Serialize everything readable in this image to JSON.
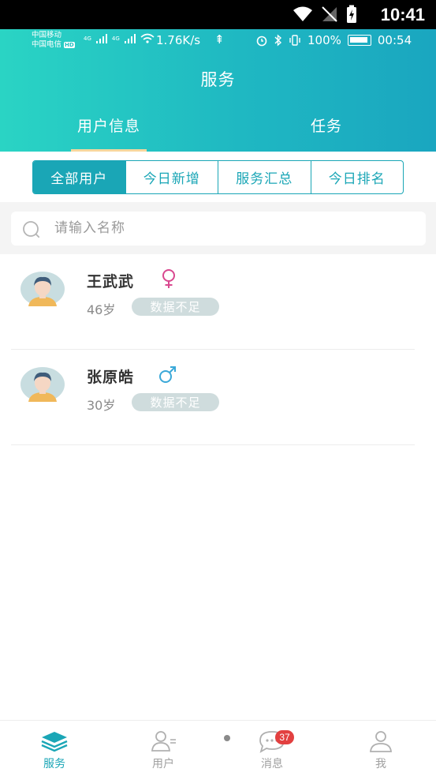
{
  "system_bar": {
    "time": "10:41"
  },
  "inner_status": {
    "carrier_1": "中国移动",
    "carrier_2": "中国电信",
    "hd": "HD",
    "net_1": "4G",
    "net_2": "4G",
    "speed": "1.76K/s",
    "battery": "100%",
    "time": "00:54"
  },
  "header": {
    "title": "服务",
    "tabs": [
      {
        "label": "用户信息",
        "active": true
      },
      {
        "label": "任务",
        "active": false
      }
    ]
  },
  "filter": {
    "options": [
      "全部用户",
      "今日新增",
      "服务汇总",
      "今日排名"
    ],
    "selected": "全部用户"
  },
  "search": {
    "placeholder": "请输入名称",
    "value": ""
  },
  "users": [
    {
      "name": "王武武",
      "gender": "female",
      "age": "46岁",
      "status": "数据不足"
    },
    {
      "name": "张原皓",
      "gender": "male",
      "age": "30岁",
      "status": "数据不足"
    }
  ],
  "bottom_nav": [
    {
      "label": "服务",
      "icon": "layers-icon",
      "active": true
    },
    {
      "label": "用户",
      "icon": "user-list-icon",
      "active": false
    },
    {
      "label": "消息",
      "icon": "chat-bubble-icon",
      "active": false,
      "badge": "37"
    },
    {
      "label": "我",
      "icon": "profile-icon",
      "active": false
    }
  ],
  "colors": {
    "accent": "#1aa6b6",
    "header_start": "#2ad4c4",
    "header_end": "#1aa6c0",
    "tab_underline": "#f6d79e",
    "female": "#d9488f",
    "male": "#3aa8d8",
    "badge_bg": "#cfdcdd",
    "notification": "#e24040"
  }
}
